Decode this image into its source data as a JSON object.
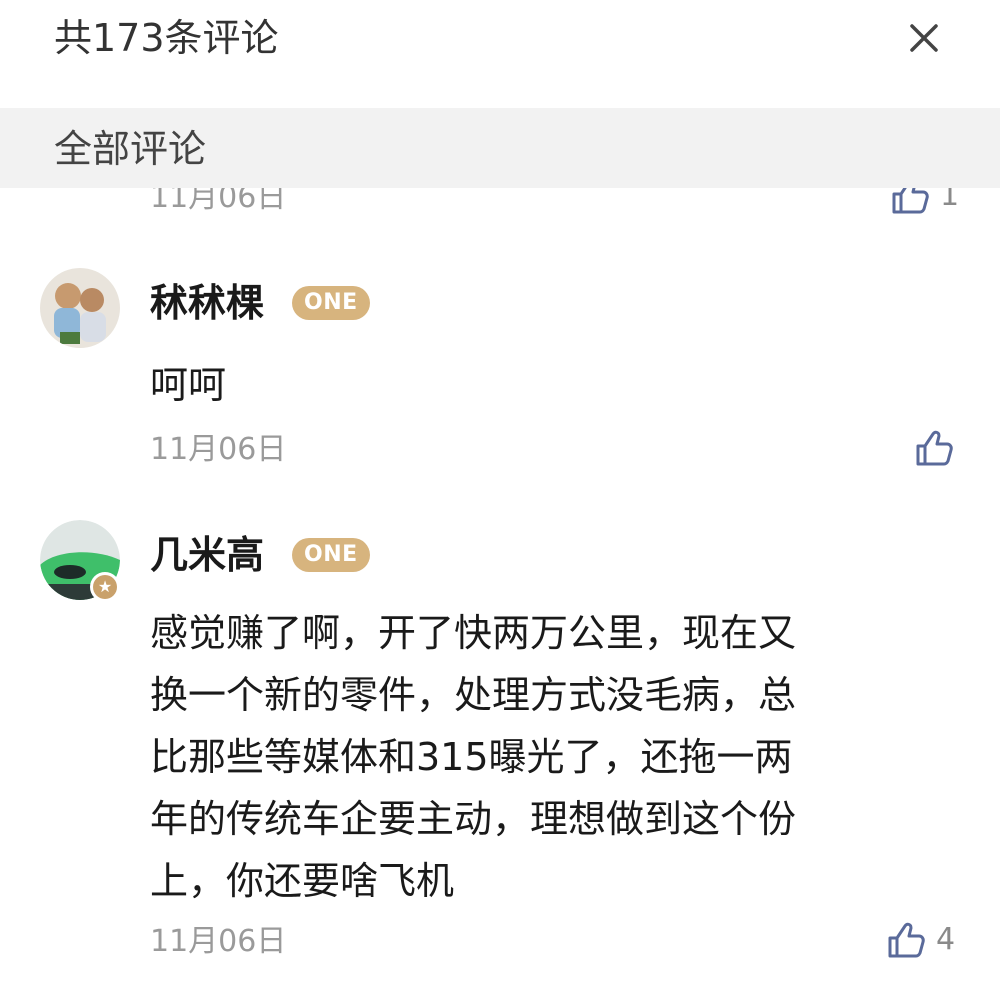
{
  "header": {
    "title": "共173条评论",
    "close_icon": "close-icon"
  },
  "section": {
    "title": "全部评论"
  },
  "comments": [
    {
      "date": "11月06日",
      "likes": "1"
    },
    {
      "username": "秫秫棵",
      "badge": "ONE",
      "text": "呵呵",
      "date": "11月06日",
      "likes": ""
    },
    {
      "username": "几米高",
      "badge": "ONE",
      "text_lines": [
        "感觉赚了啊，开了快两万公里，现在又",
        "换一个新的零件，处理方式没毛病，总",
        "比那些等媒体和315曝光了，还拖一两",
        "年的传统车企要主动，理想做到这个份",
        "上，你还要啥飞机"
      ],
      "date": "11月06日",
      "likes": "4"
    }
  ],
  "colors": {
    "badge": "#d7b47e",
    "section_bg": "#f2f2f2",
    "muted_text": "#9a9a9a"
  }
}
